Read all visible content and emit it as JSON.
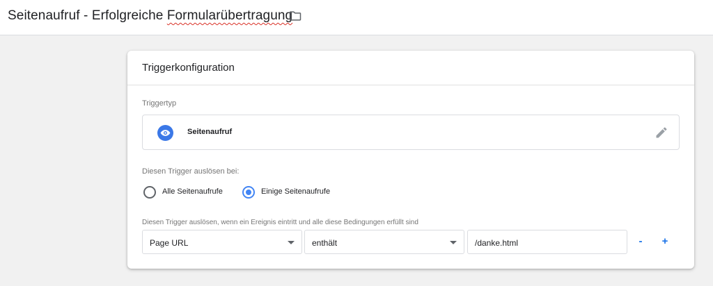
{
  "header": {
    "title_part1": "Seitenaufruf - Erfolgreiche ",
    "title_part2": "Formularübertragung",
    "folder_icon": "folder-icon"
  },
  "card": {
    "title": "Triggerkonfiguration",
    "trigger_type_label": "Triggertyp",
    "trigger_type": {
      "name": "Seitenaufruf",
      "icon": "eye-icon",
      "icon_color": "#3b78e7",
      "edit_icon": "pencil-icon"
    },
    "fire_on_label": "Diesen Trigger auslösen bei:",
    "radio_options": [
      {
        "label": "Alle Seitenaufrufe",
        "checked": false
      },
      {
        "label": "Einige Seitenaufrufe",
        "checked": true
      }
    ],
    "conditions_label": "Diesen Trigger auslösen, wenn ein Ereignis eintritt und alle diese Bedingungen erfüllt sind",
    "condition": {
      "variable": "Page URL",
      "operator": "enthält",
      "value": "/danke.html"
    },
    "remove_label": "-",
    "add_label": "+"
  },
  "colors": {
    "accent": "#4285f4",
    "link_blue": "#1a73e8",
    "background": "#f1f1f1"
  }
}
